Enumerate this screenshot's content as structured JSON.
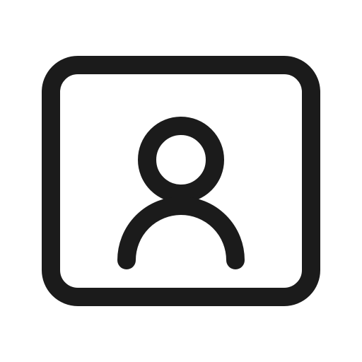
{
  "icon": {
    "name": "user-profile-icon",
    "stroke_color": "#1b1b1b",
    "background_color": "#ffffff"
  }
}
